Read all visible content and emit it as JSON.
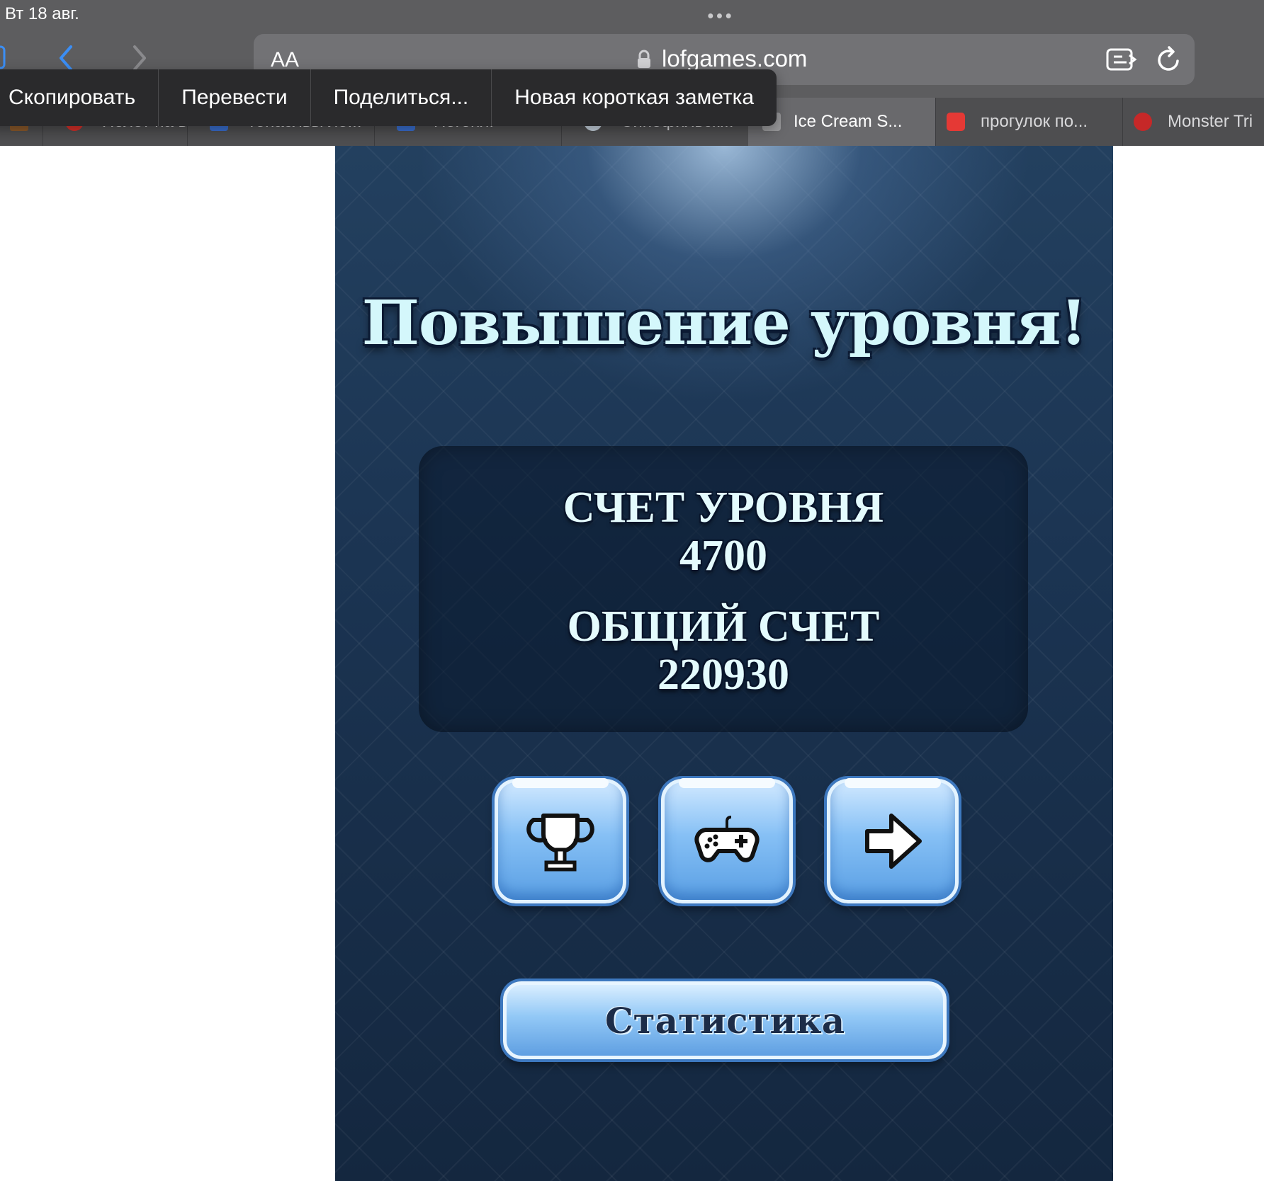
{
  "status_bar": {
    "date": "Вт 18 авг."
  },
  "address_bar": {
    "text_size_label": "AA",
    "url": "lofgames.com"
  },
  "context_menu": {
    "items": [
      {
        "label": "Скопировать"
      },
      {
        "label": "Перевести"
      },
      {
        "label": "Поделиться..."
      },
      {
        "label": "Новая короткая заметка"
      }
    ]
  },
  "tabs": [
    {
      "label": "",
      "favicon_color": "#8b5a2b"
    },
    {
      "label": "Полет на в",
      "favicon_color": "#d9302a"
    },
    {
      "label": "Тонасльы ле...",
      "favicon_color": "#3a6fd0"
    },
    {
      "label": "Погоня:",
      "favicon_color": "#3a6fd0"
    },
    {
      "label": "Синефильск...",
      "favicon_color": "#c8d4e0"
    },
    {
      "label": "Ice Cream S...",
      "favicon_color": "#9a9a9c",
      "active": true
    },
    {
      "label": "прогулок по...",
      "favicon_color": "#e53935"
    },
    {
      "label": "Monster Tri",
      "favicon_color": "#c62828"
    }
  ],
  "game": {
    "title": "Повышение уровня!",
    "level_score_label": "СЧЕТ УРОВНЯ",
    "level_score": "4700",
    "total_score_label": "ОБЩИЙ СЧЕТ",
    "total_score": "220930",
    "buttons": [
      {
        "icon": "trophy-icon"
      },
      {
        "icon": "gamepad-icon"
      },
      {
        "icon": "arrow-right-icon"
      }
    ],
    "stats_label": "Статистика"
  },
  "colors": {
    "chrome_bg": "#5d5d5f",
    "tab_bar_bg": "#4e4e50",
    "game_bg": "#1b3452",
    "title_text": "#d4f7fb",
    "button_blue": "#86c0f5"
  }
}
